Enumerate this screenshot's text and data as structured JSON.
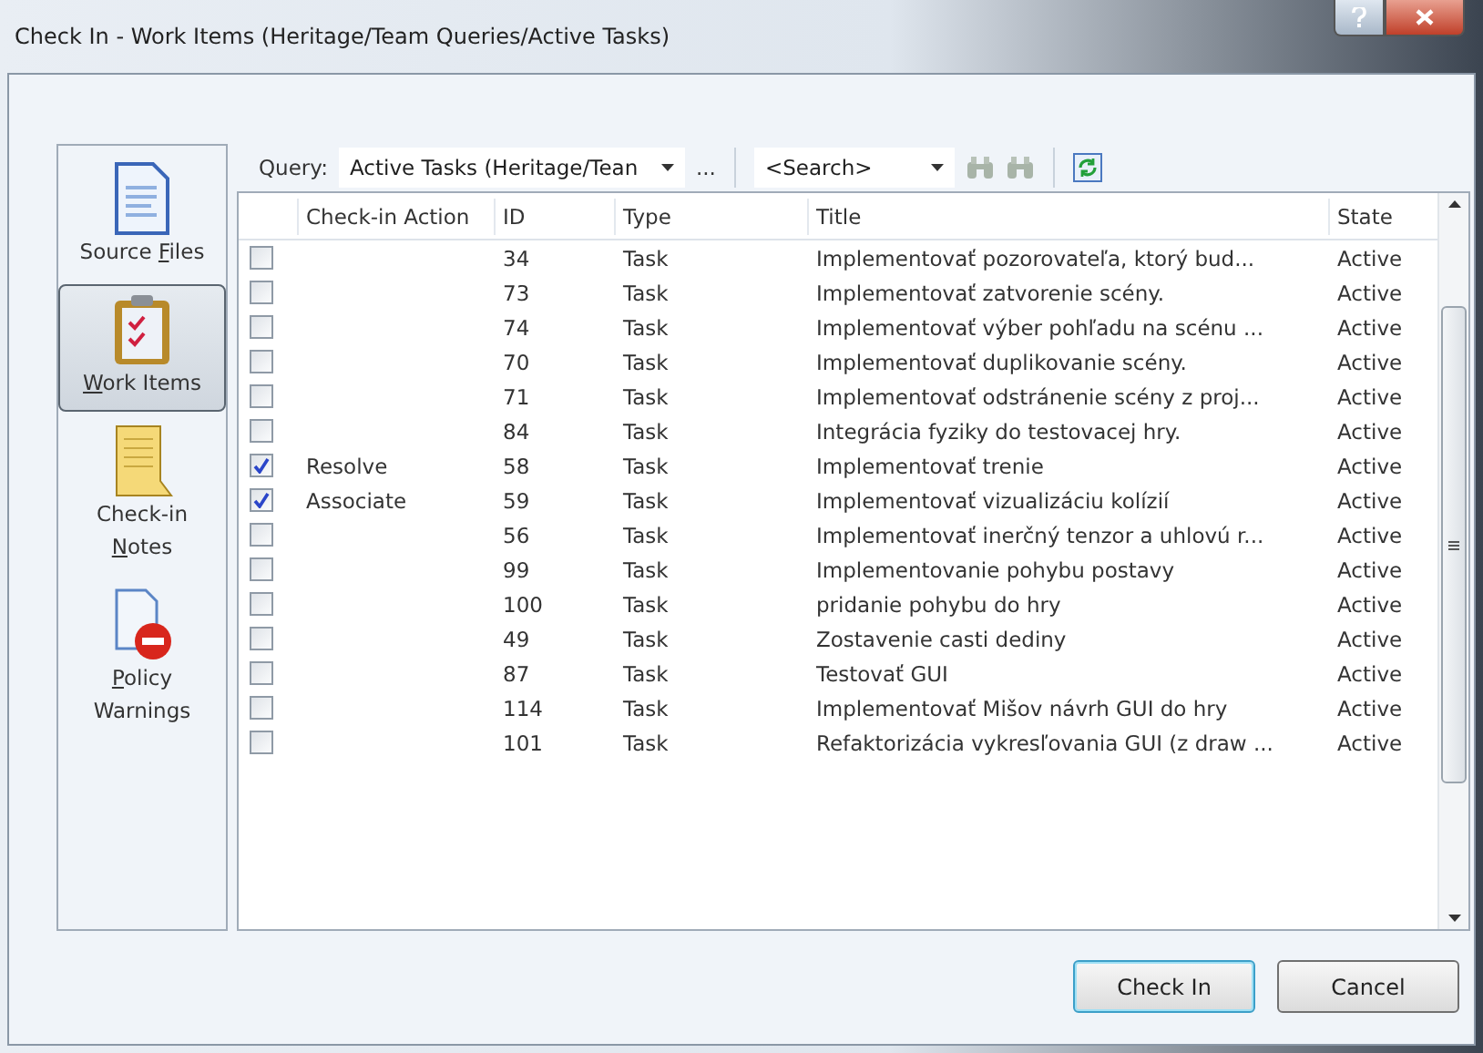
{
  "window": {
    "title": "Check In - Work Items (Heritage/Team Queries/Active Tasks)"
  },
  "sidebar": {
    "items": [
      {
        "kind": "files",
        "lines": [
          {
            "pre": "Source ",
            "key": "F",
            "post": "iles"
          }
        ],
        "selected": false
      },
      {
        "kind": "workitems",
        "lines": [
          {
            "key": "W",
            "post": "ork Items"
          }
        ],
        "selected": true
      },
      {
        "kind": "notes",
        "lines": [
          {
            "pre": "Check-in"
          },
          {
            "key": "N",
            "post": "otes"
          }
        ],
        "selected": false
      },
      {
        "kind": "policy",
        "lines": [
          {
            "key": "P",
            "post": "olicy"
          },
          {
            "pre": "Warnings"
          }
        ],
        "selected": false
      }
    ]
  },
  "toolbar": {
    "query_label": "Query:",
    "query_value": "Active Tasks (Heritage/Tean",
    "more": "...",
    "search_placeholder": "<Search>"
  },
  "table": {
    "columns": [
      "Check-in Action",
      "ID",
      "Type",
      "Title",
      "State"
    ],
    "rows": [
      {
        "checked": false,
        "action": "",
        "id": "34",
        "type": "Task",
        "title": "Implementovať pozorovateľa, ktorý bud...",
        "state": "Active"
      },
      {
        "checked": false,
        "action": "",
        "id": "73",
        "type": "Task",
        "title": "Implementovať zatvorenie scény.",
        "state": "Active"
      },
      {
        "checked": false,
        "action": "",
        "id": "74",
        "type": "Task",
        "title": "Implementovať výber pohľadu na scénu ...",
        "state": "Active"
      },
      {
        "checked": false,
        "action": "",
        "id": "70",
        "type": "Task",
        "title": "Implementovať duplikovanie scény.",
        "state": "Active"
      },
      {
        "checked": false,
        "action": "",
        "id": "71",
        "type": "Task",
        "title": "Implementovať odstránenie scény z proj...",
        "state": "Active"
      },
      {
        "checked": false,
        "action": "",
        "id": "84",
        "type": "Task",
        "title": "Integrácia fyziky do testovacej hry.",
        "state": "Active"
      },
      {
        "checked": true,
        "action": "Resolve",
        "id": "58",
        "type": "Task",
        "title": "Implementovať trenie",
        "state": "Active"
      },
      {
        "checked": true,
        "action": "Associate",
        "id": "59",
        "type": "Task",
        "title": "Implementovať vizualizáciu kolízií",
        "state": "Active"
      },
      {
        "checked": false,
        "action": "",
        "id": "56",
        "type": "Task",
        "title": "Implementovať inerčný tenzor a uhlovú r...",
        "state": "Active"
      },
      {
        "checked": false,
        "action": "",
        "id": "99",
        "type": "Task",
        "title": "Implementovanie pohybu postavy",
        "state": "Active"
      },
      {
        "checked": false,
        "action": "",
        "id": "100",
        "type": "Task",
        "title": "pridanie pohybu do hry",
        "state": "Active"
      },
      {
        "checked": false,
        "action": "",
        "id": "49",
        "type": "Task",
        "title": "Zostavenie casti dediny",
        "state": "Active"
      },
      {
        "checked": false,
        "action": "",
        "id": "87",
        "type": "Task",
        "title": "Testovať GUI",
        "state": "Active"
      },
      {
        "checked": false,
        "action": "",
        "id": "114",
        "type": "Task",
        "title": "Implementovať Mišov návrh GUI do hry",
        "state": "Active"
      },
      {
        "checked": false,
        "action": "",
        "id": "101",
        "type": "Task",
        "title": "Refaktorizácia vykresľovania GUI (z draw ...",
        "state": "Active"
      }
    ]
  },
  "buttons": [
    {
      "label": "Check In",
      "default": true
    },
    {
      "label": "Cancel",
      "default": false
    }
  ]
}
